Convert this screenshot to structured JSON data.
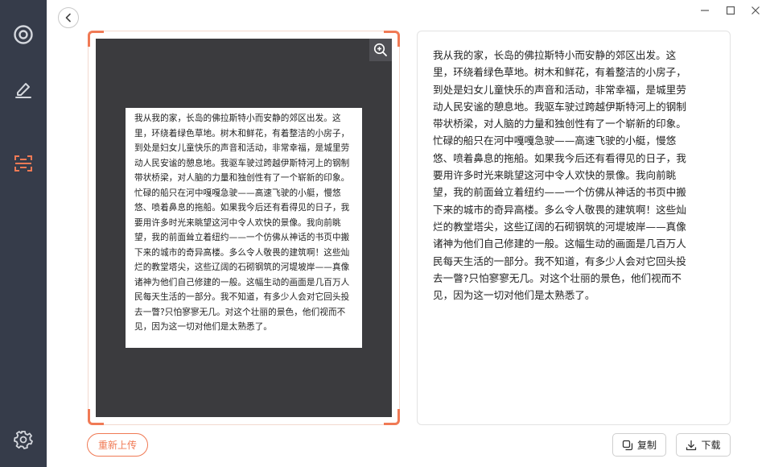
{
  "sidebar": {
    "items": [
      {
        "icon": "target-icon"
      },
      {
        "icon": "pen-edit-icon"
      },
      {
        "icon": "scan-text-icon",
        "active_color": "#f07a55"
      },
      {
        "icon": "gear-icon"
      }
    ]
  },
  "document_text": "我从我的家，长岛的佛拉斯特小而安静的郊区出发。这里，环绕着绿色草地。树木和鲜花，有着整洁的小房子，到处是妇女儿童快乐的声音和活动，非常幸福，是城里劳动人民安谧的憩息地。我驱车驶过跨越伊斯特河上的钢制带状桥梁，对人脑的力量和独创性有了一个崭新的印象。忙碌的船只在河中嘎嘎急驶——高速飞驶的小艇，慢悠悠、喷着鼻息的拖船。如果我今后还有看得见的日子，我要用许多时光来眺望这河中令人欢快的景像。我向前眺望，我的前面耸立着纽约——一个仿佛从神话的书页中搬下来的城市的奇异高楼。多么令人敬畏的建筑啊！这些灿烂的教堂塔尖，这些辽阔的石砌钢筑的河堤坡岸——真像诸神为他们自己修建的一般。这幅生动的画面是几百万人民每天生活的一部分。我不知道，有多少人会对它回头投去一瞥?只怕寥寥无几。对这个壮丽的景色，他们视而不见，因为这一切对他们是太熟悉了。",
  "ocr_result": "我从我的家，长岛的佛拉斯特小而安静的郊区出发。这里，环绕着绿色草地。树木和鲜花，有着整洁的小房子，到处是妇女儿童快乐的声音和活动，非常幸福，是城里劳动人民安谧的憩息地。我驱车驶过跨越伊斯特河上的钢制带状桥梁，对人脑的力量和独创性有了一个崭新的印象。忙碌的船只在河中嘎嘎急驶——高速飞驶的小艇，慢悠悠、喷着鼻息的拖船。如果我今后还有看得见的日子，我要用许多时光来眺望这河中令人欢快的景像。我向前眺望，我的前面耸立着纽约——一个仿佛从神话的书页中搬下来的城市的奇异高楼。多么令人敬畏的建筑啊！这些灿烂的教堂塔尖，这些辽阔的石砌钢筑的河堤坡岸——真像诸神为他们自己修建的一般。这幅生动的画面是几百万人民每天生活的一部分。我不知道，有多少人会对它回头投去一瞥?只怕寥寥无几。对这个壮丽的景色，他们视而不见，因为这一切对他们是太熟悉了。",
  "buttons": {
    "reupload": "重新上传",
    "copy": "复制",
    "download": "下载"
  },
  "colors": {
    "accent": "#f07a55",
    "sidebar": "#363c4a"
  }
}
